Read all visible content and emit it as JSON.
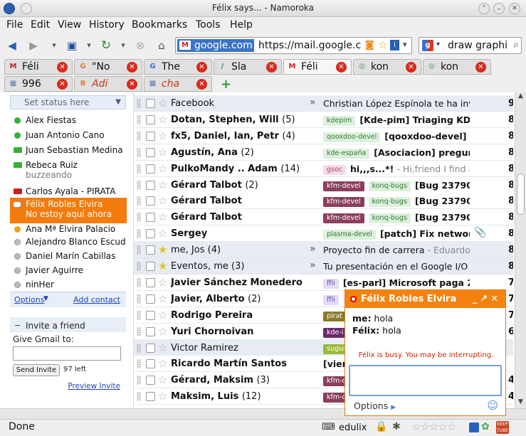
{
  "window": {
    "title": "Félix says... - Namoroka"
  },
  "menu": [
    "File",
    "Edit",
    "View",
    "History",
    "Bookmarks",
    "Tools",
    "Help"
  ],
  "nav": {
    "site_label": "google.com",
    "url": "https://mail.google.c",
    "search_value": "draw graphi"
  },
  "tabs_row1": [
    {
      "label": "Féli",
      "fav": "M",
      "fav_color": "#cc2222",
      "active": false
    },
    {
      "label": "\"No",
      "fav": "G",
      "fav_color": "#e87a2b",
      "active": false
    },
    {
      "label": "The",
      "fav": "G",
      "fav_color": "#3a6fd6",
      "active": false
    },
    {
      "label": "Sla",
      "fav": "/",
      "fav_color": "#2a8a5a",
      "active": false
    },
    {
      "label": "Féli",
      "fav": "M",
      "fav_color": "#cc2222",
      "active": true
    },
    {
      "label": "kon",
      "fav": "◎",
      "fav_color": "#4a8a4a",
      "active": false
    },
    {
      "label": "kon",
      "fav": "◎",
      "fav_color": "#4a8a4a",
      "active": false
    }
  ],
  "tabs_row2": [
    {
      "label": "996",
      "fav": "▦",
      "fav_color": "#5a7ab0",
      "italic": false
    },
    {
      "label": "Adi",
      "fav": "B",
      "fav_color": "#f07a1e",
      "italic": true
    },
    {
      "label": "cha",
      "fav": "▦",
      "fav_color": "#5a7ab0",
      "italic": true
    }
  ],
  "status_select": "Set status here",
  "contacts": [
    {
      "name": "Alex Fiestas",
      "status": "green",
      "sub": ""
    },
    {
      "name": "Juan Antonio Cano",
      "status": "green",
      "sub": ""
    },
    {
      "name": "Juan Sebastian Medina",
      "status": "video",
      "sub": ""
    },
    {
      "name": "Rebeca Ruiz",
      "status": "video",
      "sub": "buzzeando"
    },
    {
      "name": "Carlos Ayala - PIRATA",
      "status": "video-red",
      "sub": ""
    },
    {
      "name": "Félix Robles Elvira",
      "status": "chat",
      "sub": "No estoy aquí ahora",
      "selected": true
    },
    {
      "name": "Ana Mª Elvira Palacio",
      "status": "orange",
      "sub": ""
    },
    {
      "name": "Alejandro Blanco Escud",
      "status": "gray",
      "sub": ""
    },
    {
      "name": "Daniel Marín Cabillas",
      "status": "gray",
      "sub": ""
    },
    {
      "name": "Javier Aguirre",
      "status": "gray",
      "sub": ""
    },
    {
      "name": "ninHer",
      "status": "gray",
      "sub": ""
    }
  ],
  "contacts_footer": {
    "options": "Options",
    "add": "Add contact"
  },
  "invite": {
    "title": "Invite a friend",
    "give_label": "Give Gmail to:",
    "send_button": "Send Invite",
    "left": "97 left",
    "preview": "Preview Invite"
  },
  "mails": [
    {
      "from": "Facebook",
      "count": "",
      "read": true,
      "starred": false,
      "arrow": true,
      "labels": [],
      "subject": "Christian López Espínola te ha invit",
      "snippet": "",
      "date": "9"
    },
    {
      "from": "Dotan, Stephen, Will",
      "count": "(5)",
      "read": false,
      "starred": false,
      "arrow": false,
      "labels": [
        {
          "t": "kdepim",
          "bg": "#ddf0dd",
          "fg": "#2f7a2f"
        }
      ],
      "subject": "[Kde-pim] Triaging KDE",
      "snippet": "",
      "date": "8"
    },
    {
      "from": "fx5, Daniel, Ian, Petr",
      "count": "(4)",
      "read": false,
      "starred": false,
      "arrow": false,
      "labels": [
        {
          "t": "qooxdoo-devel",
          "bg": "#ddf0dd",
          "fg": "#2f7a2f"
        }
      ],
      "subject": "[qooxdoo-devel] I",
      "snippet": "",
      "date": "8"
    },
    {
      "from": "Agustín, Ana",
      "count": "(2)",
      "read": false,
      "starred": false,
      "arrow": false,
      "labels": [
        {
          "t": "kde-españa",
          "bg": "#ddf0dd",
          "fg": "#2f7a2f"
        }
      ],
      "subject": "[Asociacion] pregun",
      "snippet": "",
      "date": "8"
    },
    {
      "from": "PulkoMandy .. Adam",
      "count": "(14)",
      "read": false,
      "starred": false,
      "arrow": false,
      "labels": [
        {
          "t": "gsoc",
          "bg": "#f5dbe8",
          "fg": "#b03a78"
        }
      ],
      "subject": "hi,,,s...*!",
      "snippet": " - Hi,friend I find a",
      "date": "8"
    },
    {
      "from": "Gérard Talbot",
      "count": "(2)",
      "read": false,
      "starred": false,
      "arrow": false,
      "labels": [
        {
          "t": "kfm-devel",
          "bg": "#8a3f5c",
          "fg": "#ffffff"
        },
        {
          "t": "konq-bugs",
          "bg": "#ddf0dd",
          "fg": "#2f7a2f"
        }
      ],
      "subject": "[Bug 23790",
      "snippet": "",
      "date": "8"
    },
    {
      "from": "Gérard Talbot",
      "count": "",
      "read": false,
      "starred": false,
      "arrow": false,
      "labels": [
        {
          "t": "kfm-devel",
          "bg": "#8a3f5c",
          "fg": "#ffffff"
        },
        {
          "t": "konq-bugs",
          "bg": "#ddf0dd",
          "fg": "#2f7a2f"
        }
      ],
      "subject": "[Bug 23790",
      "snippet": "",
      "date": "8"
    },
    {
      "from": "Gérard Talbot",
      "count": "",
      "read": false,
      "starred": false,
      "arrow": false,
      "labels": [
        {
          "t": "kfm-devel",
          "bg": "#8a3f5c",
          "fg": "#ffffff"
        },
        {
          "t": "konq-bugs",
          "bg": "#ddf0dd",
          "fg": "#2f7a2f"
        }
      ],
      "subject": "[Bug 23790",
      "snippet": "",
      "date": "8"
    },
    {
      "from": "Sergey",
      "count": "",
      "read": false,
      "starred": false,
      "arrow": false,
      "labels": [
        {
          "t": "plasma-devel",
          "bg": "#ddf0dd",
          "fg": "#2f7a2f"
        }
      ],
      "subject": "[patch] Fix networ",
      "snippet": "",
      "date": "8",
      "clip": true
    },
    {
      "from": "me, Jos",
      "count": "(4)",
      "read": true,
      "starred": true,
      "arrow": true,
      "labels": [],
      "subject": "Proyecto fin de carrera",
      "snippet": " - Eduardo R",
      "date": "8"
    },
    {
      "from": "Eventos, me",
      "count": "(3)",
      "read": true,
      "starred": true,
      "arrow": true,
      "labels": [],
      "subject": "Tu presentación en el Google I/O",
      "snippet": " -",
      "date": "8"
    },
    {
      "from": "Javier Sánchez Monedero",
      "count": "",
      "read": false,
      "starred": false,
      "arrow": false,
      "labels": [
        {
          "t": "ffii",
          "bg": "#e3dcf5",
          "fg": "#6a4ab8"
        }
      ],
      "subject": "[es-parl] Microsoft paga 200",
      "snippet": "",
      "date": "7"
    },
    {
      "from": "Javier, Alberto",
      "count": "(2)",
      "read": false,
      "starred": false,
      "arrow": false,
      "labels": [
        {
          "t": "ffii",
          "bg": "#e3dcf5",
          "fg": "#6a4ab8"
        }
      ],
      "subject": "",
      "snippet": "",
      "date": "7"
    },
    {
      "from": "Rodrigo Pereira",
      "count": "",
      "read": false,
      "starred": false,
      "arrow": false,
      "labels": [
        {
          "t": "pirat",
          "bg": "#8a7a2a",
          "fg": "#ffffff"
        }
      ],
      "subject": "",
      "snippet": "",
      "date": "7"
    },
    {
      "from": "Yuri Chornoivan",
      "count": "",
      "read": false,
      "starred": false,
      "arrow": false,
      "labels": [
        {
          "t": "kde-i",
          "bg": "#6a2a6a",
          "fg": "#ffffff"
        }
      ],
      "subject": "",
      "snippet": "",
      "date": "6"
    },
    {
      "from": "Victor Ramirez",
      "count": "",
      "read": true,
      "starred": false,
      "arrow": false,
      "labels": [
        {
          "t": "sugus",
          "bg": "#9ab83a",
          "fg": "#ffffff"
        }
      ],
      "subject": "",
      "snippet": "",
      "date": ""
    },
    {
      "from": "Ricardo Martín Santos",
      "count": "",
      "read": false,
      "starred": false,
      "arrow": false,
      "labels": [],
      "subject": "[vier",
      "snippet": "",
      "date": ""
    },
    {
      "from": "Gérard, Maksim",
      "count": "(3)",
      "read": false,
      "starred": false,
      "arrow": false,
      "labels": [
        {
          "t": "kfm-d",
          "bg": "#8a3f5c",
          "fg": "#ffffff"
        }
      ],
      "subject": "",
      "snippet": "",
      "date": "4"
    },
    {
      "from": "Maksim, Luis",
      "count": "(12)",
      "read": false,
      "starred": false,
      "arrow": false,
      "labels": [
        {
          "t": "kfm-d",
          "bg": "#8a3f5c",
          "fg": "#ffffff"
        }
      ],
      "subject": "",
      "snippet": "",
      "date": "4"
    }
  ],
  "chat": {
    "title": "Félix Robles Elvira",
    "messages": [
      {
        "who": "me:",
        "text": "hola"
      },
      {
        "who": "Félix:",
        "text": "hola"
      }
    ],
    "busy": "Félix is busy. You may be interrupting.",
    "options": "Options"
  },
  "statusbar": {
    "text": "Done",
    "user": "edulix"
  }
}
